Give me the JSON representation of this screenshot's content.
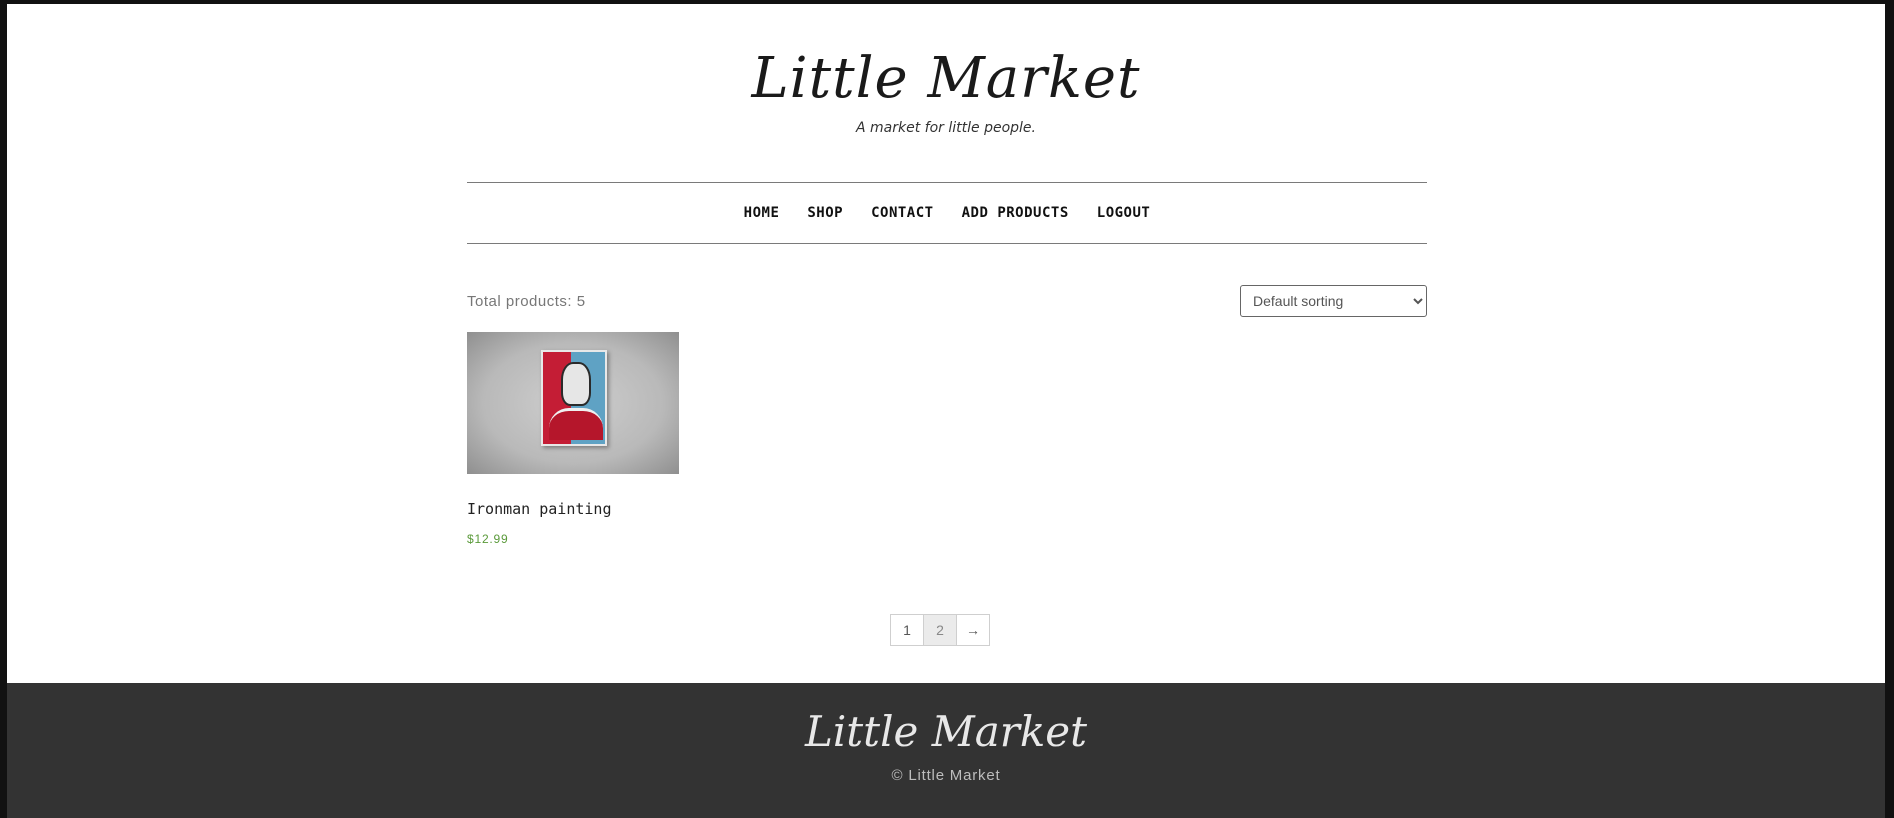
{
  "header": {
    "site_title": "Little Market",
    "tagline": "A market for little people."
  },
  "nav": {
    "items": [
      {
        "label": "HOME"
      },
      {
        "label": "SHOP"
      },
      {
        "label": "CONTACT"
      },
      {
        "label": "ADD PRODUCTS"
      },
      {
        "label": "LOGOUT"
      }
    ]
  },
  "shop": {
    "total_products": "Total products: 5",
    "sort": {
      "selected": "Default sorting"
    },
    "products": [
      {
        "name": "Ironman painting",
        "price": "$12.99",
        "image_icon": "ironman-painting-image"
      }
    ]
  },
  "pagination": {
    "pages": [
      "1",
      "2"
    ],
    "current": "2",
    "next": "→"
  },
  "footer": {
    "logo": "Little Market",
    "copyright": "© Little Market"
  },
  "colors": {
    "price": "#5a9a3a",
    "footer_bg": "#333333"
  }
}
